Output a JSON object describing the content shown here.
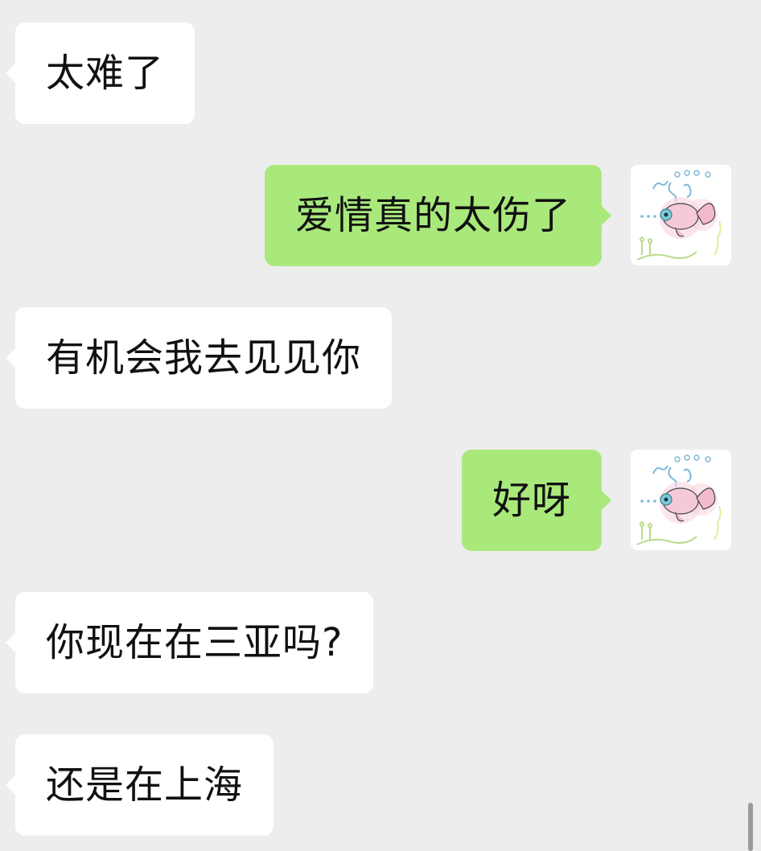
{
  "messages": [
    {
      "side": "left",
      "text": "太难了"
    },
    {
      "side": "right",
      "text": "爱情真的太伤了",
      "avatar": "goldfish-avatar"
    },
    {
      "side": "left",
      "text": "有机会我去见见你"
    },
    {
      "side": "right",
      "text": "好呀",
      "avatar": "goldfish-avatar"
    },
    {
      "side": "left",
      "text": "你现在在三亚吗?"
    },
    {
      "side": "left",
      "text": "还是在上海"
    }
  ],
  "colors": {
    "background": "#ededed",
    "incoming_bubble": "#ffffff",
    "outgoing_bubble": "#a9e97b",
    "text": "#111111"
  }
}
